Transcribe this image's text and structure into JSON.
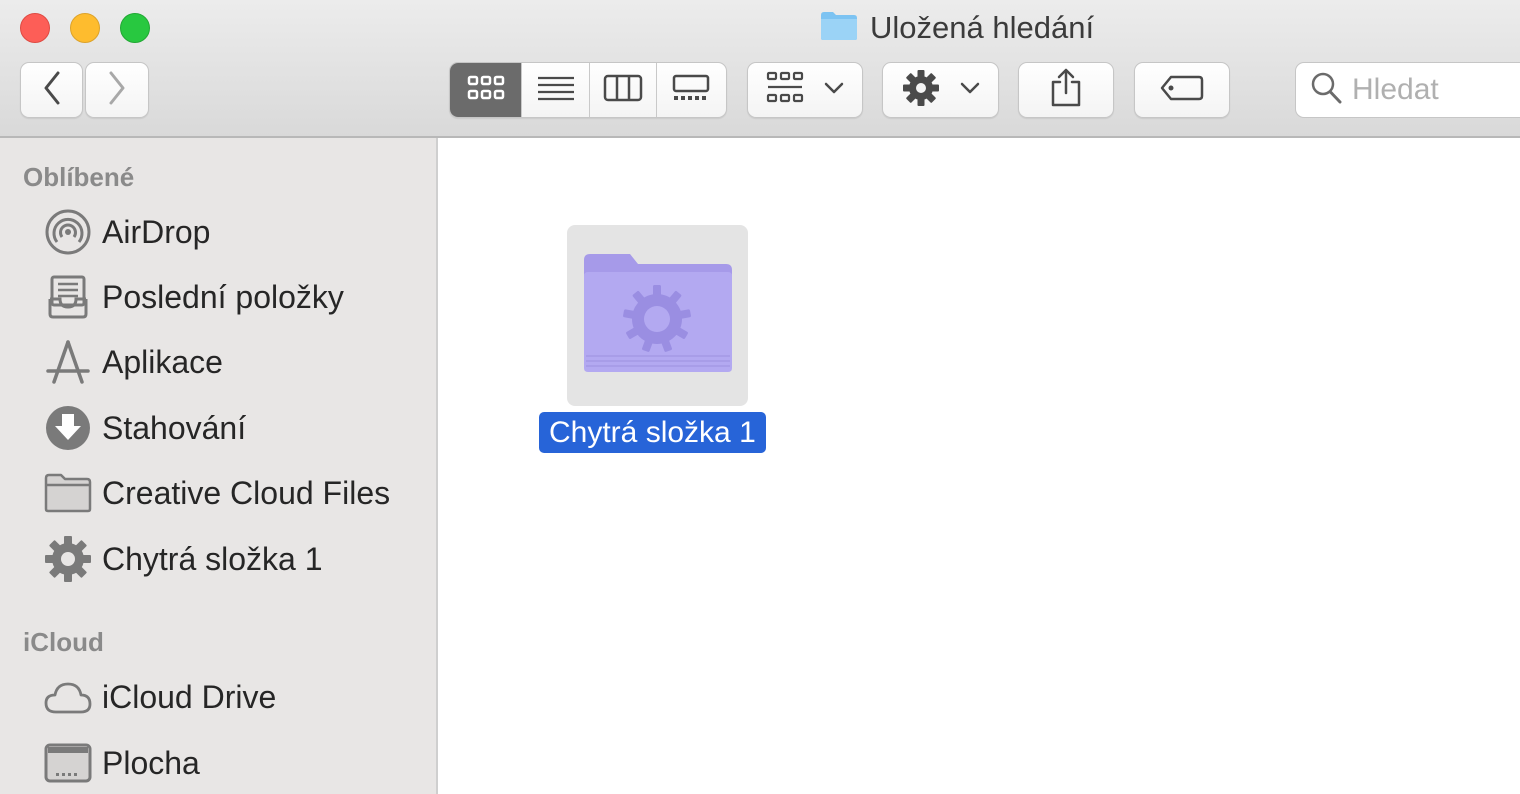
{
  "window": {
    "title": "Uložená hledání",
    "title_icon": "folder-icon"
  },
  "toolbar": {
    "back_icon": "chevron-left-icon",
    "forward_icon": "chevron-right-icon",
    "view_modes": [
      "icon-view",
      "list-view",
      "column-view",
      "gallery-view"
    ],
    "active_view": "icon-view",
    "group_icon": "group-grid-icon",
    "action_icon": "gear-icon",
    "share_icon": "share-icon",
    "tag_icon": "tag-icon",
    "search_placeholder": "Hledat"
  },
  "sidebar": {
    "favorites_title": "Oblíbené",
    "favorites": [
      {
        "label": "AirDrop",
        "icon": "airdrop-icon"
      },
      {
        "label": "Poslední položky",
        "icon": "recents-icon"
      },
      {
        "label": "Aplikace",
        "icon": "applications-icon"
      },
      {
        "label": "Stahování",
        "icon": "downloads-icon"
      },
      {
        "label": "Creative Cloud Files",
        "icon": "folder-icon"
      },
      {
        "label": "Chytrá složka 1",
        "icon": "gear-icon"
      }
    ],
    "icloud_title": "iCloud",
    "icloud": [
      {
        "label": "iCloud Drive",
        "icon": "cloud-icon"
      },
      {
        "label": "Plocha",
        "icon": "desktop-icon"
      }
    ]
  },
  "content": {
    "items": [
      {
        "label": "Chytrá složka 1",
        "icon": "smart-folder-icon",
        "selected": true
      }
    ]
  },
  "colors": {
    "selection": "#2764d8",
    "smart_folder": "#b3a9f1"
  }
}
